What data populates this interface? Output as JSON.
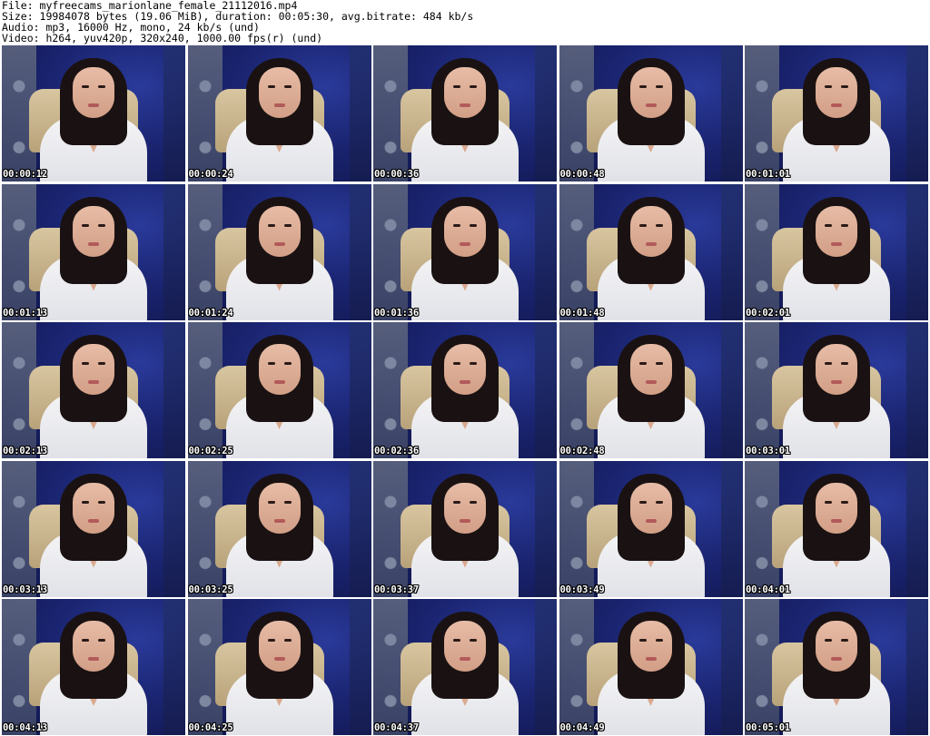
{
  "header": {
    "line1": "File: myfreecams_marionlane_female_21112016.mp4",
    "line2": "Size: 19984078 bytes (19.06 MiB), duration: 00:05:30, avg.bitrate: 484 kb/s",
    "line3": "Audio: mp3, 16000 Hz, mono, 24 kb/s (und)",
    "line4": "Video: h264, yuv420p, 320x240, 1000.00 fps(r) (und)"
  },
  "thumbnails": [
    {
      "time": "00:00:12"
    },
    {
      "time": "00:00:24"
    },
    {
      "time": "00:00:36"
    },
    {
      "time": "00:00:48"
    },
    {
      "time": "00:01:01"
    },
    {
      "time": "00:01:13"
    },
    {
      "time": "00:01:24"
    },
    {
      "time": "00:01:36"
    },
    {
      "time": "00:01:48"
    },
    {
      "time": "00:02:01"
    },
    {
      "time": "00:02:13"
    },
    {
      "time": "00:02:25"
    },
    {
      "time": "00:02:36"
    },
    {
      "time": "00:02:48"
    },
    {
      "time": "00:03:01"
    },
    {
      "time": "00:03:13"
    },
    {
      "time": "00:03:25"
    },
    {
      "time": "00:03:37"
    },
    {
      "time": "00:03:49"
    },
    {
      "time": "00:04:01"
    },
    {
      "time": "00:04:13"
    },
    {
      "time": "00:04:25"
    },
    {
      "time": "00:04:37"
    },
    {
      "time": "00:04:49"
    },
    {
      "time": "00:05:01"
    }
  ],
  "colors": {
    "background": "#ffffff",
    "header_text": "#000000",
    "timestamp_text": "#ffffff",
    "backdrop": "#1b2763"
  }
}
